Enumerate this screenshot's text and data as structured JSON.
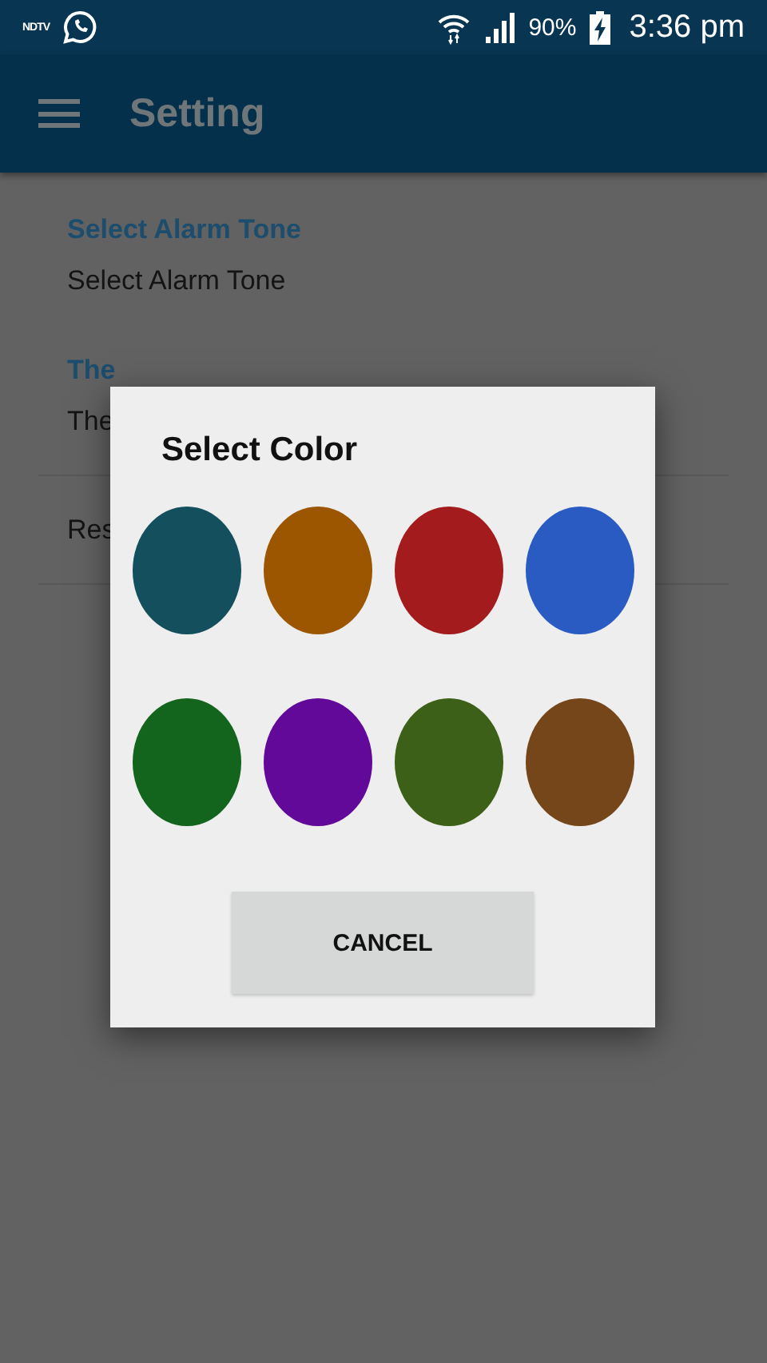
{
  "status_bar": {
    "app_label": "NDTV",
    "battery": "90%",
    "time": "3:36 pm"
  },
  "toolbar": {
    "title": "Setting"
  },
  "settings": [
    {
      "kind": "header",
      "text": "Select Alarm Tone"
    },
    {
      "kind": "item",
      "text": "Select Alarm Tone"
    },
    {
      "kind": "header",
      "text": "The"
    },
    {
      "kind": "item",
      "text": "The"
    },
    {
      "kind": "item",
      "text": "Res"
    }
  ],
  "dialog": {
    "title": "Select Color",
    "colors": [
      {
        "color": "#134f5c"
      },
      {
        "color": "#9c5600"
      },
      {
        "color": "#a31b1d"
      },
      {
        "color": "#2a5bc2"
      },
      {
        "color": "#13651d"
      },
      {
        "color": "#62099a"
      },
      {
        "color": "#3c6017"
      },
      {
        "color": "#76461b"
      }
    ],
    "button": "CANCEL"
  }
}
